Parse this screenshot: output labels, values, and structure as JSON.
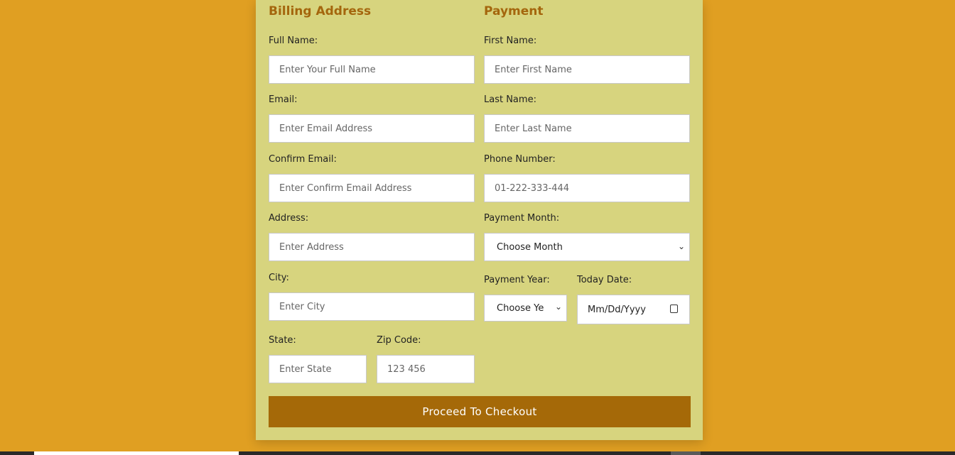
{
  "billing": {
    "heading": "Billing Address",
    "full_name": {
      "label": "Full Name:",
      "placeholder": "Enter Your Full Name"
    },
    "email": {
      "label": "Email:",
      "placeholder": "Enter Email Address"
    },
    "confirm_email": {
      "label": "Confirm Email:",
      "placeholder": "Enter Confirm Email Address"
    },
    "address": {
      "label": "Address:",
      "placeholder": "Enter Address"
    },
    "city": {
      "label": "City:",
      "placeholder": "Enter City"
    },
    "state": {
      "label": "State:",
      "placeholder": "Enter State"
    },
    "zip": {
      "label": "Zip Code:",
      "placeholder": "123 456"
    }
  },
  "payment": {
    "heading": "Payment",
    "first_name": {
      "label": "First Name:",
      "placeholder": "Enter First Name"
    },
    "last_name": {
      "label": "Last Name:",
      "placeholder": "Enter Last Name"
    },
    "phone": {
      "label": "Phone Number:",
      "placeholder": "01-222-333-444"
    },
    "month": {
      "label": "Payment Month:",
      "selected": "Choose Month"
    },
    "year": {
      "label": "Payment Year:",
      "selected": "Choose Ye"
    },
    "date": {
      "label": "Today Date:",
      "value": "Mm/Dd/Yyyy"
    }
  },
  "icons": {
    "dropdown": "chevron-down-icon",
    "calendar": "calendar-icon"
  },
  "submit_label": "Proceed To Checkout",
  "colors": {
    "background": "#e09f22",
    "card": "#d7d47e",
    "heading": "#a4660d",
    "button": "#a56908"
  }
}
